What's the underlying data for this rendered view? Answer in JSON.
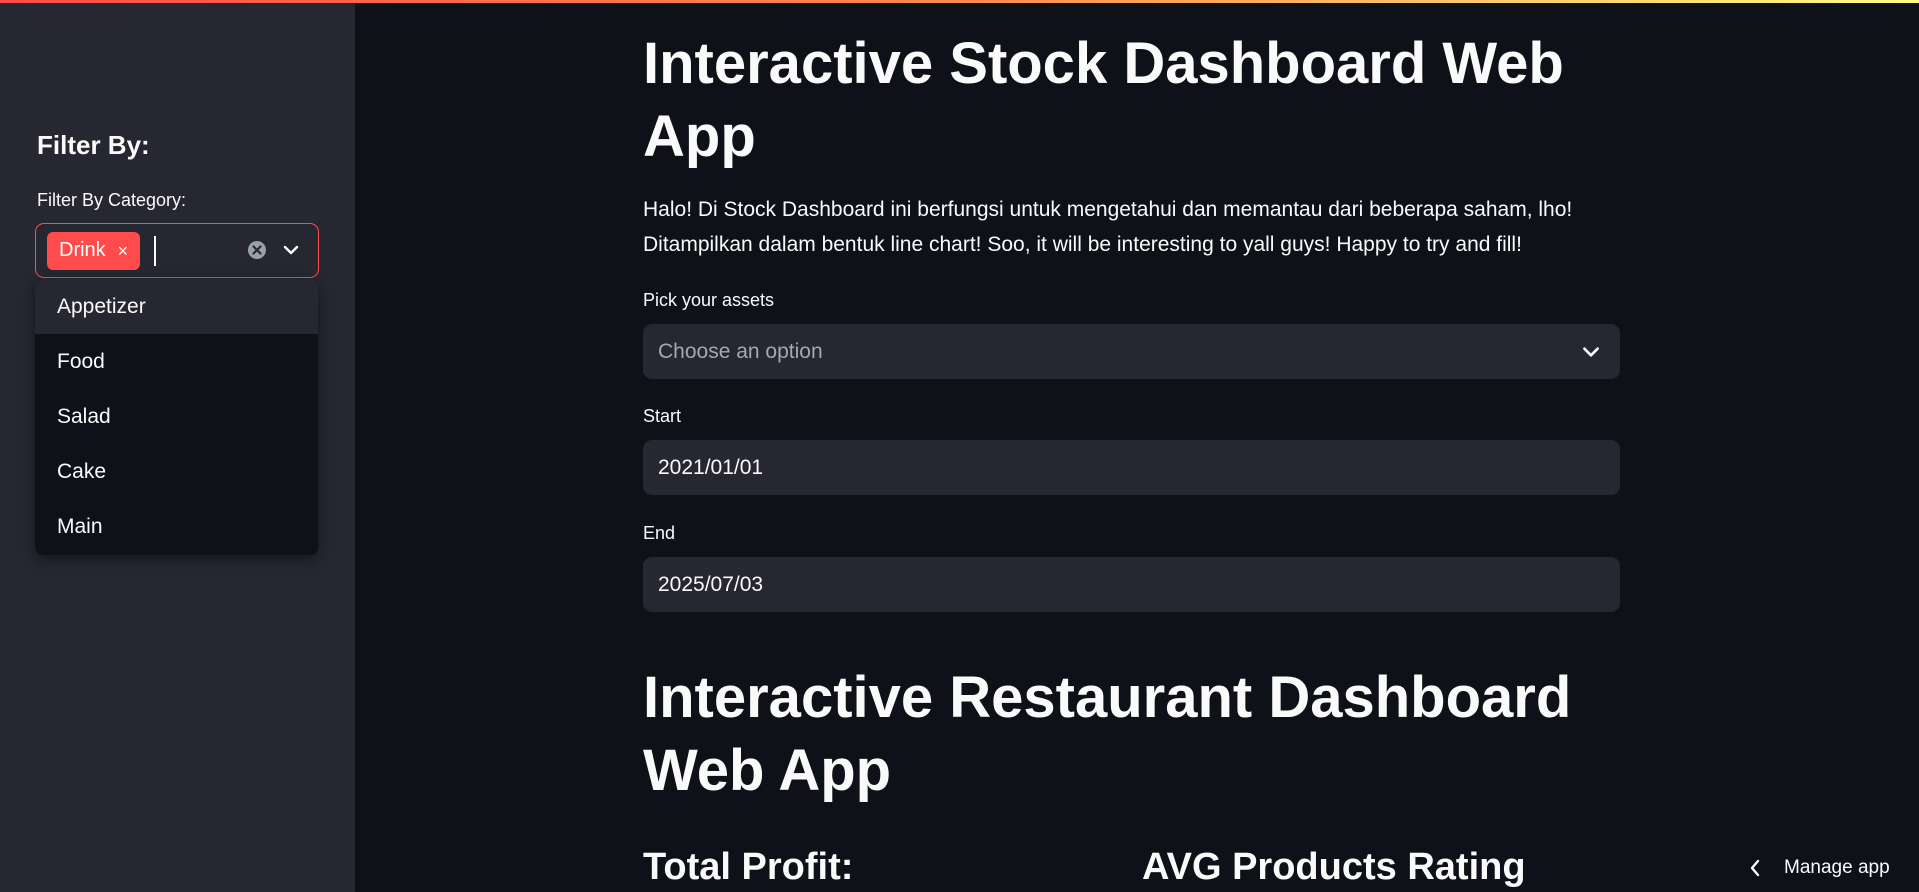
{
  "sidebar": {
    "heading": "Filter By:",
    "category_label": "Filter By Category:",
    "selected_tags": [
      "Drink"
    ],
    "tag_remove_glyph": "×",
    "dropdown_options": [
      "Appetizer",
      "Food",
      "Salad",
      "Cake",
      "Main"
    ]
  },
  "main": {
    "stock_title": "Interactive Stock Dashboard Web App",
    "stock_description": "Halo! Di Stock Dashboard ini berfungsi untuk mengetahui dan memantau dari beberapa saham, lho! Ditampilkan dalam bentuk line chart! Soo, it will be interesting to yall guys! Happy to try and fill!",
    "assets": {
      "label": "Pick your assets",
      "placeholder": "Choose an option"
    },
    "start": {
      "label": "Start",
      "value": "2021/01/01"
    },
    "end": {
      "label": "End",
      "value": "2025/07/03"
    },
    "restaurant_title": "Interactive Restaurant Dashboard Web App",
    "total_profit_label": "Total Profit:",
    "avg_rating_label": "AVG Products Rating"
  },
  "footer": {
    "manage_app": "Manage app"
  },
  "colors": {
    "accent": "#ff4b4b",
    "background": "#0e1117",
    "sidebar": "#262730"
  },
  "icons": {
    "clear": "clear-circle-icon",
    "chevron": "chevron-down-icon",
    "manage": "chevron-left-icon"
  }
}
